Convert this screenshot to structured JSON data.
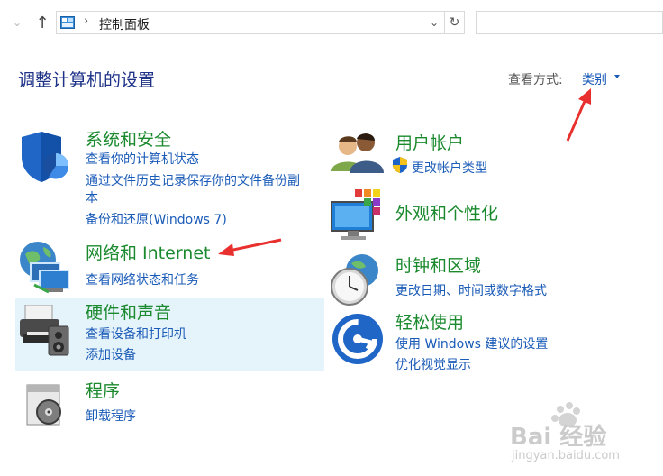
{
  "address_bar": {
    "path": "控制面板",
    "separator": "›"
  },
  "header": {
    "title": "调整计算机的设置",
    "view_by_label": "查看方式:",
    "view_by_value": "类别"
  },
  "categories": [
    {
      "id": "system-security",
      "icon": "shield-icon",
      "title": "系统和安全",
      "links": [
        "查看你的计算机状态",
        "通过文件历史记录保存你的文件备份副",
        "本",
        "备份和还原(Windows 7)"
      ]
    },
    {
      "id": "network",
      "icon": "network-globe-icon",
      "title": "网络和 Internet",
      "links": [
        "查看网络状态和任务"
      ]
    },
    {
      "id": "hardware",
      "icon": "printer-speaker-icon",
      "title": "硬件和声音",
      "links": [
        "查看设备和打印机",
        "添加设备"
      ]
    },
    {
      "id": "programs",
      "icon": "programs-disc-icon",
      "title": "程序",
      "links": [
        "卸载程序"
      ]
    },
    {
      "id": "user-accounts",
      "icon": "users-icon",
      "title": "用户帐户",
      "links": [
        "更改帐户类型"
      ]
    },
    {
      "id": "appearance",
      "icon": "monitor-palette-icon",
      "title": "外观和个性化",
      "links": []
    },
    {
      "id": "clock-region",
      "icon": "clock-globe-icon",
      "title": "时钟和区域",
      "links": [
        "更改日期、时间或数字格式"
      ]
    },
    {
      "id": "ease-of-access",
      "icon": "ease-of-access-icon",
      "title": "轻松使用",
      "links": [
        "使用 Windows 建议的设置",
        "优化视觉显示"
      ]
    }
  ],
  "watermark": {
    "line1": "Bai 经验",
    "line2": "jingyan.baidu.com"
  },
  "colors": {
    "title_green": "#1b8a2e",
    "link_blue": "#1a5bb7",
    "header_blue": "#1e3287",
    "highlight": "#e5f3fb",
    "annotation_red": "#e8312f"
  }
}
